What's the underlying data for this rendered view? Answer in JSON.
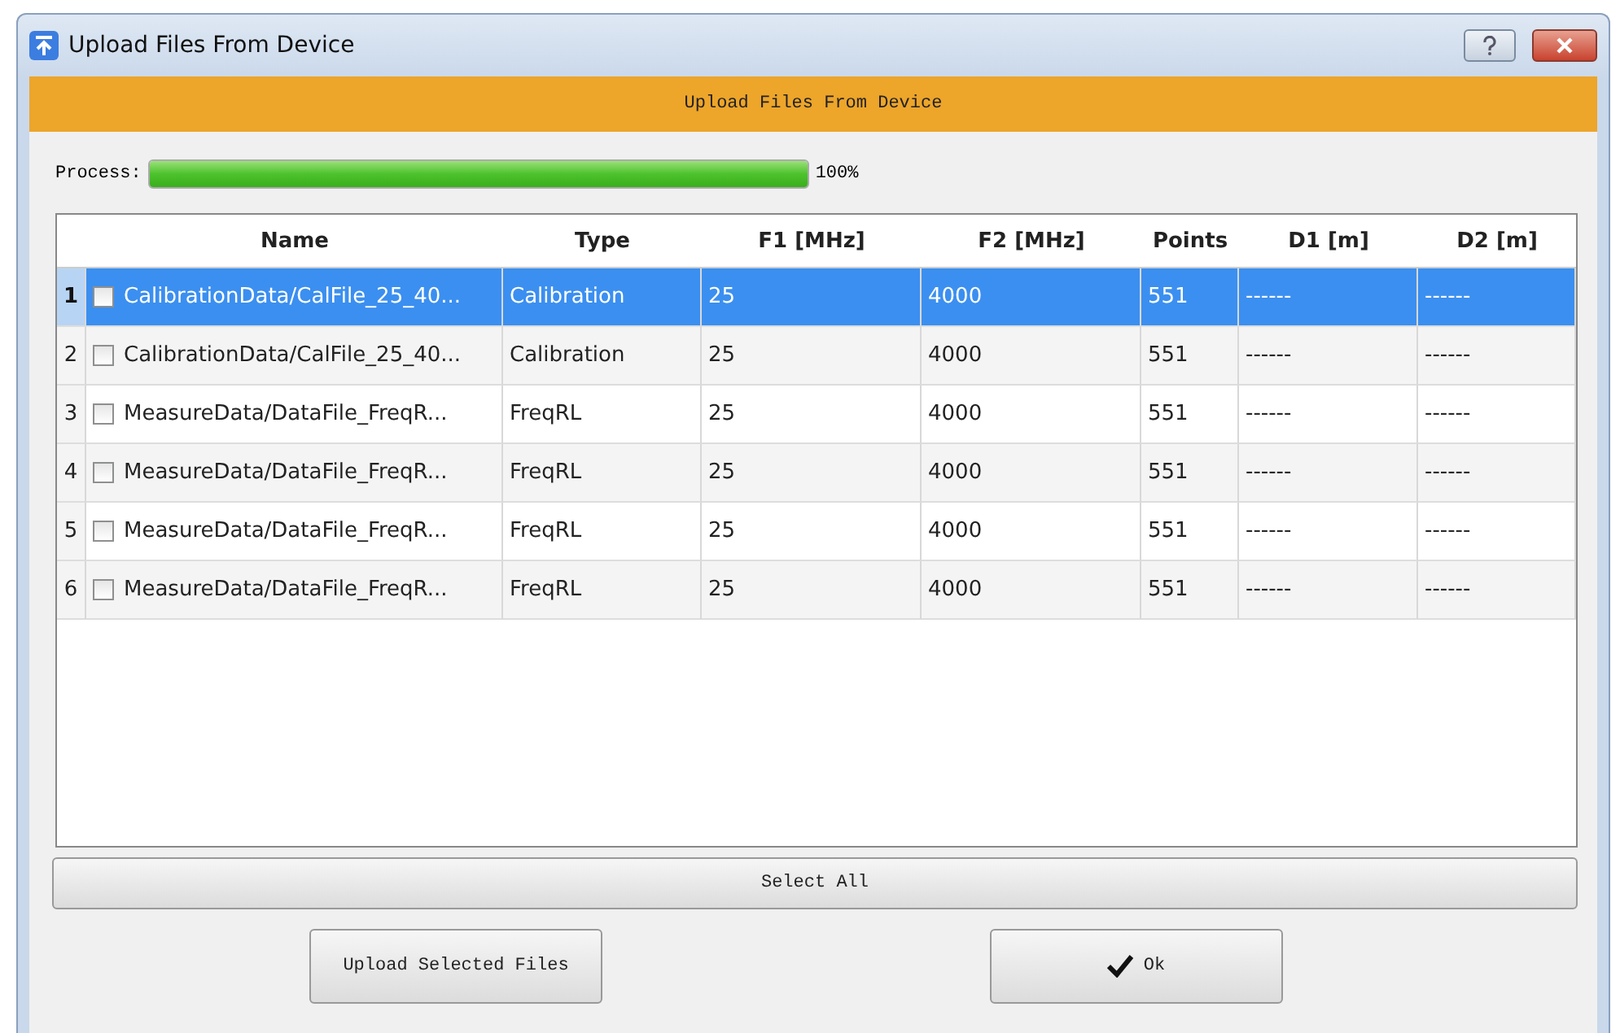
{
  "window": {
    "title": "Upload Files From Device"
  },
  "banner": "Upload Files From Device",
  "progress": {
    "label": "Process:",
    "level": 1,
    "reading": "100%"
  },
  "table": {
    "columns": [
      "Name",
      "Type",
      "F1 [MHz]",
      "F2 [MHz]",
      "Points",
      "D1 [m]",
      "D2 [m]"
    ],
    "rows": [
      {
        "number": "1",
        "selected": true,
        "checked": false,
        "cells": [
          "CalibrationData/CalFile_25_40...",
          "Calibration",
          "25",
          "4000",
          "551",
          "------",
          "------"
        ]
      },
      {
        "number": "2",
        "selected": false,
        "checked": false,
        "cells": [
          "CalibrationData/CalFile_25_40...",
          "Calibration",
          "25",
          "4000",
          "551",
          "------",
          "------"
        ]
      },
      {
        "number": "3",
        "selected": false,
        "checked": false,
        "cells": [
          "MeasureData/DataFile_FreqR...",
          "FreqRL",
          "25",
          "4000",
          "551",
          "------",
          "------"
        ]
      },
      {
        "number": "4",
        "selected": false,
        "checked": false,
        "cells": [
          "MeasureData/DataFile_FreqR...",
          "FreqRL",
          "25",
          "4000",
          "551",
          "------",
          "------"
        ]
      },
      {
        "number": "5",
        "selected": false,
        "checked": false,
        "cells": [
          "MeasureData/DataFile_FreqR...",
          "FreqRL",
          "25",
          "4000",
          "551",
          "------",
          "------"
        ]
      },
      {
        "number": "6",
        "selected": false,
        "checked": false,
        "cells": [
          "MeasureData/DataFile_FreqR...",
          "FreqRL",
          "25",
          "4000",
          "551",
          "------",
          "------"
        ]
      }
    ]
  },
  "select_all": "Select All",
  "buttons": [
    {
      "label": "Upload Selected Files",
      "kind": "plain"
    },
    {
      "label": "Ok",
      "kind": "check"
    }
  ]
}
